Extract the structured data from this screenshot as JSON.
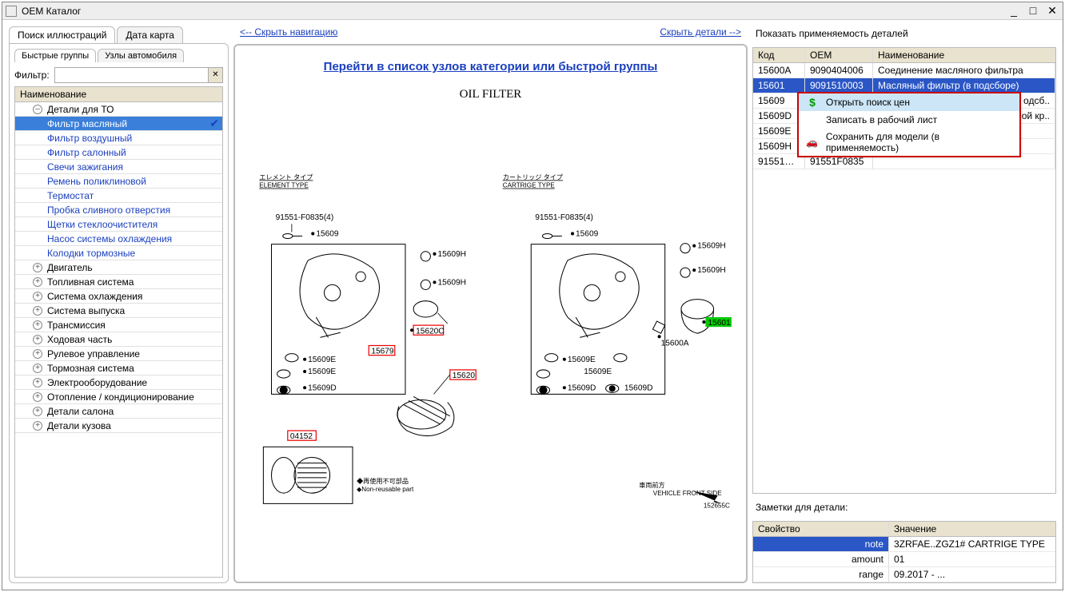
{
  "window": {
    "title": "OEM Каталог"
  },
  "left": {
    "tabs": [
      {
        "label": "Поиск иллюстраций",
        "active": true
      },
      {
        "label": "Дата карта",
        "active": false
      }
    ],
    "subtabs": [
      {
        "label": "Быстрые группы",
        "active": true
      },
      {
        "label": "Узлы автомобиля",
        "active": false
      }
    ],
    "filter_label": "Фильтр:",
    "tree_header": "Наименование",
    "tree": {
      "group0": {
        "label": "Детали для ТО",
        "subs": [
          "Фильтр масляный",
          "Фильтр воздушный",
          "Фильтр салонный",
          "Свечи зажигания",
          "Ремень поликлиновой",
          "Термостат",
          "Пробка сливного отверстия",
          "Щетки стеклоочистителя",
          "Насос системы охлаждения",
          "Колодки тормозные"
        ]
      },
      "others": [
        "Двигатель",
        "Топливная система",
        "Система охлаждения",
        "Система выпуска",
        "Трансмиссия",
        "Ходовая часть",
        "Рулевое управление",
        "Тормозная система",
        "Электрооборудование",
        "Отопление / кондиционирование",
        "Детали салона",
        "Детали кузова"
      ]
    }
  },
  "nav": {
    "hide_nav": "<-- Скрыть навигацию",
    "hide_detail": "Скрыть детали -->"
  },
  "diagram": {
    "category_link": "Перейти в список узлов категории или быстрой группы",
    "title": "OIL FILTER",
    "subheads": {
      "left_jp": "エレメント タイプ",
      "left_en": "ELEMENT TYPE",
      "right_jp": "カートリッジ タイプ",
      "right_en": "CARTRIGE TYPE"
    },
    "labels": {
      "bolt": "91551-F0835(4)",
      "l15609": "15609",
      "l15609H": "15609H",
      "l15620C": "15620C",
      "l15679": "15679",
      "l15609E": "15609E",
      "l15609D": "15609D",
      "l15620": "15620",
      "l04152": "04152",
      "l15600A": "15600A",
      "l15601": "15601",
      "reuse_jp": "◆再使用不可部品",
      "reuse_en": "◆Non-reusable part",
      "front_jp": "車両前方",
      "front_en": "VEHICLE FRONT SIDE",
      "imgid": "152655C"
    }
  },
  "right": {
    "applic_title": "Показать применяемость деталей",
    "headers": {
      "code": "Код",
      "oem": "OEM",
      "name": "Наименование"
    },
    "rows": [
      {
        "code": "15600A",
        "oem": "9090404006",
        "name": "Соединение масляного фильтра"
      },
      {
        "code": "15601",
        "oem": "9091510003",
        "name": "Масляный фильтр (в подсборе)",
        "selected": true
      },
      {
        "code": "15609",
        "oem": "",
        "name": "одсб..",
        "truncated_left": true
      },
      {
        "code": "15609D",
        "oem": "",
        "name": "ой кр..",
        "truncated_left": true
      },
      {
        "code": "15609E",
        "oem": "",
        "name": ""
      },
      {
        "code": "15609H",
        "oem": "",
        "name": ""
      },
      {
        "code": "91551F08..",
        "oem": "91551F0835",
        "name": ""
      }
    ],
    "ctx": {
      "open_prices": "Открыть поиск цен",
      "write_sheet": "Записать в рабочий лист",
      "save_model": "Сохранить для модели (в применяемость)"
    },
    "notes_title": "Заметки для детали:",
    "notes_headers": {
      "prop": "Свойство",
      "val": "Значение"
    },
    "notes": [
      {
        "prop": "note",
        "val": "3ZRFAE..ZGZ1# CARTRIGE TYPE",
        "selected": true
      },
      {
        "prop": "amount",
        "val": "01"
      },
      {
        "prop": "range",
        "val": "09.2017 - ..."
      }
    ]
  }
}
